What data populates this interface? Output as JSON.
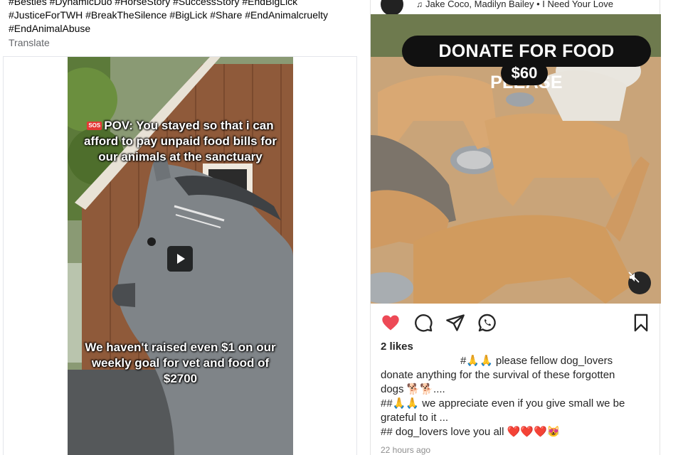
{
  "facebook_post": {
    "hashtag_lines": [
      "#Besties #DynamicDuo #HorseStory #SuccessStory #EndBigLick",
      "#JusticeForTWH #BreakTheSilence #BigLick #Share #EndAnimalcruelty",
      "#EndAnimalAbuse"
    ],
    "translate_label": "Translate",
    "video": {
      "sos_badge": "SOS",
      "top_caption": "POV: You stayed so that i can afford to pay unpaid food bills for our animals at the sanctuary",
      "bottom_caption": "We haven't raised even $1 on our weekly goal for vet and food of $2700"
    }
  },
  "instagram_post": {
    "music": "Jake Coco, Madilyn Bailey • I Need Your Love",
    "image": {
      "headline": "DONATE FOR FOOD PLEASE",
      "amount": "$60"
    },
    "likes": "2 likes",
    "caption_lines": [
      "#🙏🙏 please fellow dog_lovers",
      "donate anything for the survival of these forgotten",
      "dogs 🐕🐕....",
      "##🙏🙏 we appreciate even if you give small we be",
      "grateful to it ...",
      "## dog_lovers love you all ❤️❤️❤️😻"
    ],
    "timestamp": "22 hours ago",
    "colors": {
      "like": "#ed4956",
      "text": "#262626",
      "muted": "#8e8e8e"
    }
  }
}
